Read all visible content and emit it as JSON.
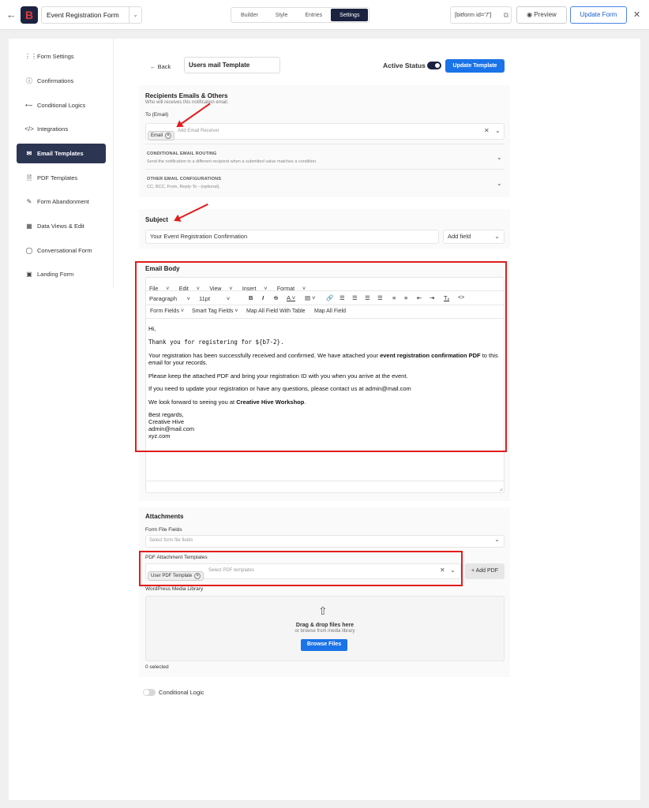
{
  "topbar": {
    "form_name": "Event Registration Form",
    "tabs": [
      "Builder",
      "Style",
      "Entries",
      "Settings"
    ],
    "active_tab": "Settings",
    "shortcode": "[bitform id='7']",
    "preview_label": "Preview",
    "update_form_label": "Update Form"
  },
  "sidebar": {
    "items": [
      {
        "label": "Form Settings",
        "icon": "sliders-icon"
      },
      {
        "label": "Confirmations",
        "icon": "info-icon"
      },
      {
        "label": "Conditional Logics",
        "icon": "logic-icon"
      },
      {
        "label": "Integrations",
        "icon": "code-icon"
      },
      {
        "label": "Email Templates",
        "icon": "mail-icon",
        "active": true
      },
      {
        "label": "PDF Templates",
        "icon": "pdf-icon"
      },
      {
        "label": "Form Abandonment",
        "icon": "abandon-icon"
      },
      {
        "label": "Data Views & Edit",
        "icon": "table-icon"
      },
      {
        "label": "Conversational Form",
        "icon": "chat-icon"
      },
      {
        "label": "Landing Form",
        "icon": "landing-icon"
      }
    ]
  },
  "header": {
    "back_label": "Back",
    "template_name": "Users mail Template",
    "active_status_label": "Active Status",
    "update_template_label": "Update Template"
  },
  "recipients": {
    "title": "Recipients Emails & Others",
    "subtitle": "Who will receives this notification email.",
    "to_label": "To (Email)",
    "to_chip": "Email",
    "to_placeholder": "Add Email Receiver",
    "routing_title": "CONDITIONAL EMAIL ROUTING",
    "routing_sub": "Send the notification to a different recipient when a submitted value matches a condition.",
    "other_title": "OTHER EMAIL CONFIGURATIONS",
    "other_sub": "CC, BCC, From, Reply-To --(optional)."
  },
  "subject": {
    "title": "Subject",
    "value": "Your Event Registration Confirmation",
    "add_field_label": "Add field"
  },
  "email_body": {
    "title": "Email Body",
    "menu": [
      "File",
      "Edit",
      "View",
      "Insert",
      "Format"
    ],
    "paragraph": "Paragraph",
    "font_size": "11pt",
    "toolbar2": [
      "Form Fields",
      "Smart Tag Fields",
      "Map All Field With Table",
      "Map All Field"
    ],
    "line_hi": "Hi,",
    "line_thanks": "Thank you for registering for ${b7-2}.",
    "line_reg_a": "Your registration has been successfully received and confirmed. We have attached your",
    "line_reg_bold": "event registration confirmation PDF",
    "line_reg_b": "to this email for your records.",
    "line_keep": "Please keep the attached PDF and bring your registration ID with you when you arrive at the event.",
    "line_update": "If you need to update your registration or have any questions, please contact us at admin@mail.com",
    "line_forward_a": "We look forward to seeing you at",
    "line_forward_bold": "Creative Hive Workshop",
    "line_forward_b": ".",
    "signoff": [
      "Best regards,",
      "Creative Hive",
      "admin@mail.com",
      "xyz.com"
    ]
  },
  "attachments": {
    "title": "Attachments",
    "file_fields_label": "Form File Fields",
    "file_fields_placeholder": "Select form file fields",
    "pdf_label": "PDF Attachment Templates",
    "pdf_chip": "User PDF Template",
    "pdf_placeholder": "Select PDF templates",
    "add_pdf_label": "+ Add PDF",
    "media_label": "WordPress Media Library",
    "drag_label": "Drag & drop files here",
    "browse_sub": "or browse from media library",
    "browse_btn": "Browse Files",
    "selected": "0 selected"
  },
  "conditional_logic_label": "Conditional Logic",
  "colors": {
    "accent": "#1a73e8",
    "dark": "#1c2340",
    "highlight": "#e11d1d"
  }
}
